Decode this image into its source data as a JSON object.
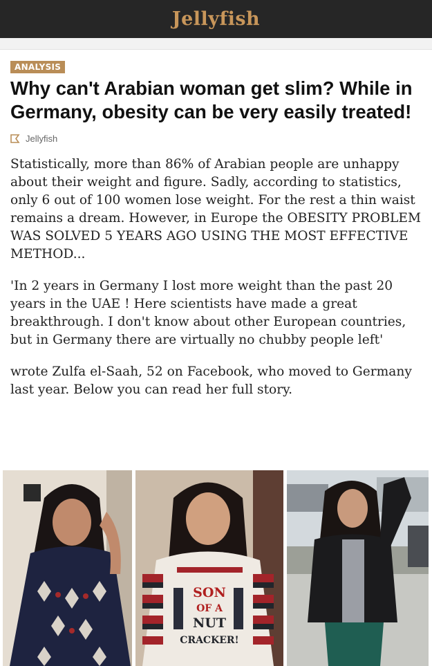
{
  "header": {
    "site_name": "Jellyfish"
  },
  "article": {
    "category_badge": "ANALYSIS",
    "headline": "Why can't Arabian woman get slim? While in Germany, obesity can be very easily treated!",
    "author": {
      "icon": "author-icon",
      "name": "Jellyfish"
    },
    "paragraphs": [
      "Statistically, more than 86% of Arabian people are unhappy about their weight and figure. Sadly, according to statistics, only 6 out of 100 women lose weight. For the rest a thin waist remains a dream. However, in Europe the OBESITY PROBLEM WAS SOLVED 5 YEARS AGO USING THE MOST EFFECTIVE METHOD...",
      "'In 2 years in Germany I lost more weight than the past 20 years in the UAE ! Here scientists have made a great breakthrough. I don't know about other European countries, but in Germany there are virtually no chubby people left'",
      "wrote Zulfa el-Saah, 52 on Facebook, who moved to Germany last year. Below you can read her full story."
    ],
    "sweater_text": [
      "SON",
      "OF A",
      "NUT",
      "CRACKER!"
    ]
  },
  "colors": {
    "topbar": "#262626",
    "brand": "#c8965a",
    "badge": "#b98d57"
  }
}
